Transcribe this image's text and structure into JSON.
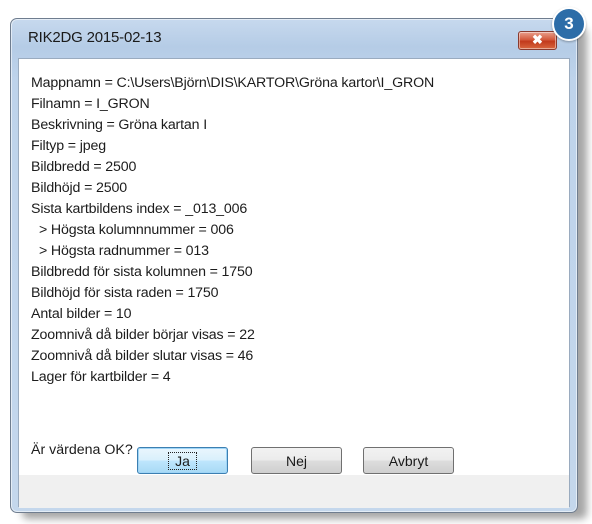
{
  "badge": "3",
  "window": {
    "title": "RIK2DG 2015-02-13",
    "close_label": "✖"
  },
  "lines": [
    "Mappnamn = C:\\Users\\Björn\\DIS\\KARTOR\\Gröna kartor\\I_GRON",
    "Filnamn = I_GRON",
    "Beskrivning = Gröna kartan I",
    "Filtyp = jpeg",
    "Bildbredd = 2500",
    "Bildhöjd = 2500",
    "Sista kartbildens index = _013_006",
    "> Högsta kolumnnummer = 006",
    "> Högsta radnummer = 013",
    "Bildbredd för sista kolumnen = 1750",
    "Bildhöjd för sista raden = 1750",
    "Antal bilder = 10",
    "Zoomnivå då bilder börjar visas = 22",
    "Zoomnivå då bilder slutar visas = 46",
    "Lager för kartbilder = 4"
  ],
  "question": "Är värdena OK?",
  "buttons": {
    "yes": "Ja",
    "no": "Nej",
    "cancel": "Avbryt"
  }
}
